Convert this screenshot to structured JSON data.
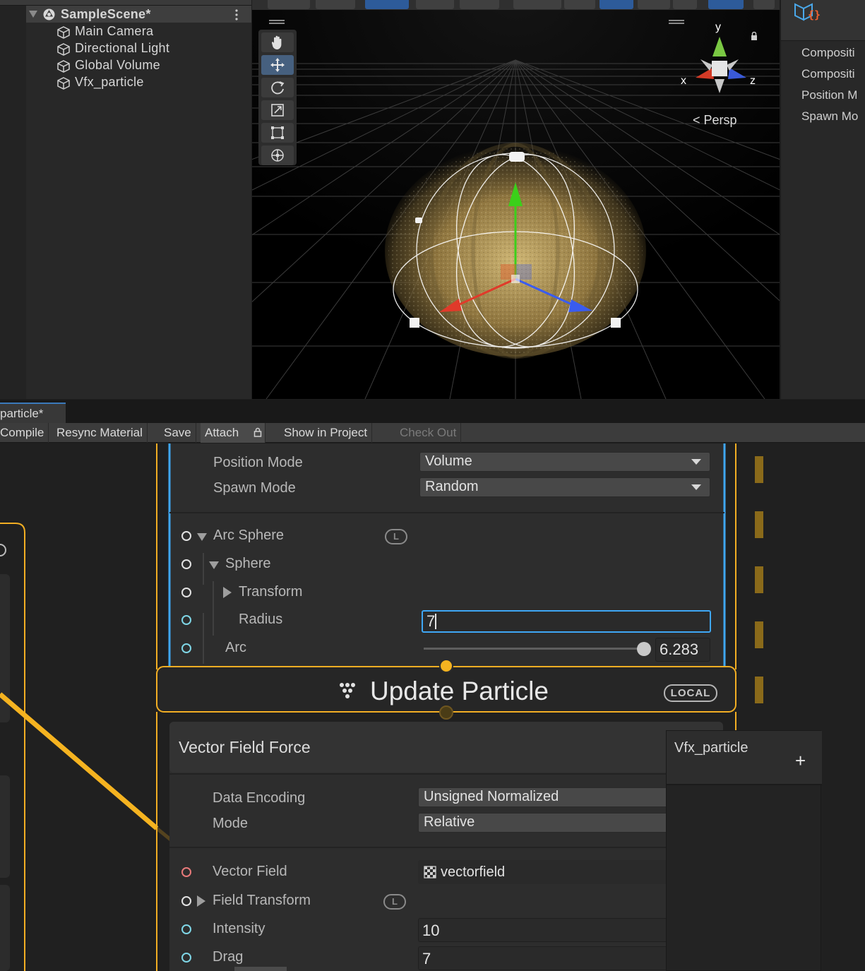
{
  "hierarchy": {
    "scene_name": "SampleScene*",
    "items": [
      {
        "label": "Main Camera"
      },
      {
        "label": "Directional Light"
      },
      {
        "label": "Global Volume"
      },
      {
        "label": "Vfx_particle"
      }
    ]
  },
  "sceneview": {
    "gizmo_axes": {
      "x": "x",
      "y": "y",
      "z": "z"
    },
    "projection_label": "Persp",
    "tools": [
      "hand-icon",
      "move-icon",
      "rotate-icon",
      "scale-icon",
      "rect-icon",
      "transform-icon"
    ],
    "active_tool_index": 1
  },
  "inspector": {
    "items": [
      "Compositi",
      "Compositi",
      "Position M",
      "Spawn Mo"
    ]
  },
  "vfx_window": {
    "tab_label": "particle*",
    "toolbar": {
      "compile": "Compile",
      "resync": "Resync Material",
      "save": "Save",
      "attach": "Attach",
      "show_in_project": "Show in Project",
      "check_out": "Check Out"
    },
    "spawn_block": {
      "position_mode_label": "Position Mode",
      "position_mode_value": "Volume",
      "spawn_mode_label": "Spawn Mode",
      "spawn_mode_value": "Random",
      "arc_sphere_label": "Arc Sphere",
      "space_badge": "L",
      "sphere_label": "Sphere",
      "transform_label": "Transform",
      "radius_label": "Radius",
      "radius_value": "7",
      "arc_label": "Arc",
      "arc_value": "6.283",
      "arc_slider_fraction": 1.0
    },
    "update_context": {
      "title": "Update Particle",
      "space_badge": "LOCAL"
    },
    "vector_field_block": {
      "title": "Vector Field Force",
      "data_encoding_label": "Data Encoding",
      "data_encoding_value": "Unsigned Normalized",
      "mode_label": "Mode",
      "mode_value": "Relative",
      "vector_field_label": "Vector Field",
      "vector_field_value": "vectorfield",
      "field_transform_label": "Field Transform",
      "field_transform_badge": "L",
      "intensity_label": "Intensity",
      "intensity_value": "10",
      "drag_label": "Drag",
      "drag_value": "7"
    },
    "blackboard": {
      "title": "Vfx_particle",
      "add_label": "+"
    }
  },
  "colors": {
    "accent_blue": "#3fa7f5",
    "context_orange": "#f2ae23",
    "edge_yellow": "#f5b320"
  }
}
